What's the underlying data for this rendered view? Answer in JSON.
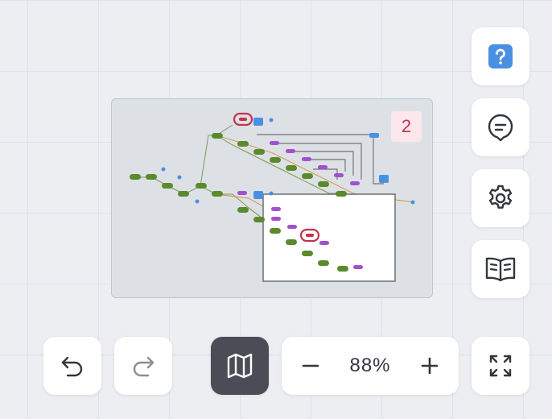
{
  "minimap": {
    "badge_count": "2",
    "colors": {
      "node": "#5b8a2d",
      "flag": "#a24fd0",
      "end": "#4a90e2",
      "ring": "#c2334d"
    }
  },
  "toolbar": {
    "zoom_level": "88%",
    "zoom_out_icon": "minus-icon",
    "zoom_in_icon": "plus-icon"
  },
  "side_buttons": [
    "help-icon",
    "comment-icon",
    "gear-icon",
    "book-icon"
  ],
  "bottom_buttons": [
    "undo-icon",
    "redo-icon",
    "map-icon",
    "fullscreen-icon"
  ]
}
